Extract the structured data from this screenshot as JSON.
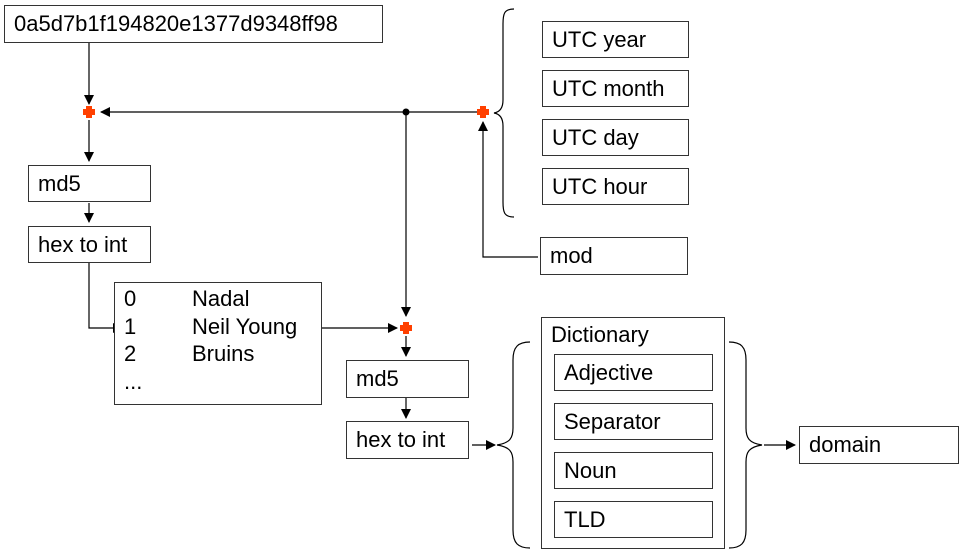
{
  "seed": "0a5d7b1f194820e1377d9348ff98",
  "left_chain": {
    "hash": "md5",
    "convert": "hex to int"
  },
  "time_inputs": [
    "UTC year",
    "UTC month",
    "UTC day",
    "UTC hour"
  ],
  "mod_label": "mod",
  "wordlist": {
    "rows": [
      {
        "index": "0",
        "word": "Nadal"
      },
      {
        "index": "1",
        "word": "Neil Young"
      },
      {
        "index": "2",
        "word": "Bruins"
      },
      {
        "index": "...",
        "word": ""
      }
    ]
  },
  "right_chain": {
    "hash": "md5",
    "convert": "hex to int"
  },
  "dictionary": {
    "title": "Dictionary",
    "parts": [
      "Adjective",
      "Separator",
      "Noun",
      "TLD"
    ]
  },
  "output_label": "domain",
  "colors": {
    "combine_node": "#ff4000",
    "line": "#000000",
    "border": "#333333"
  }
}
